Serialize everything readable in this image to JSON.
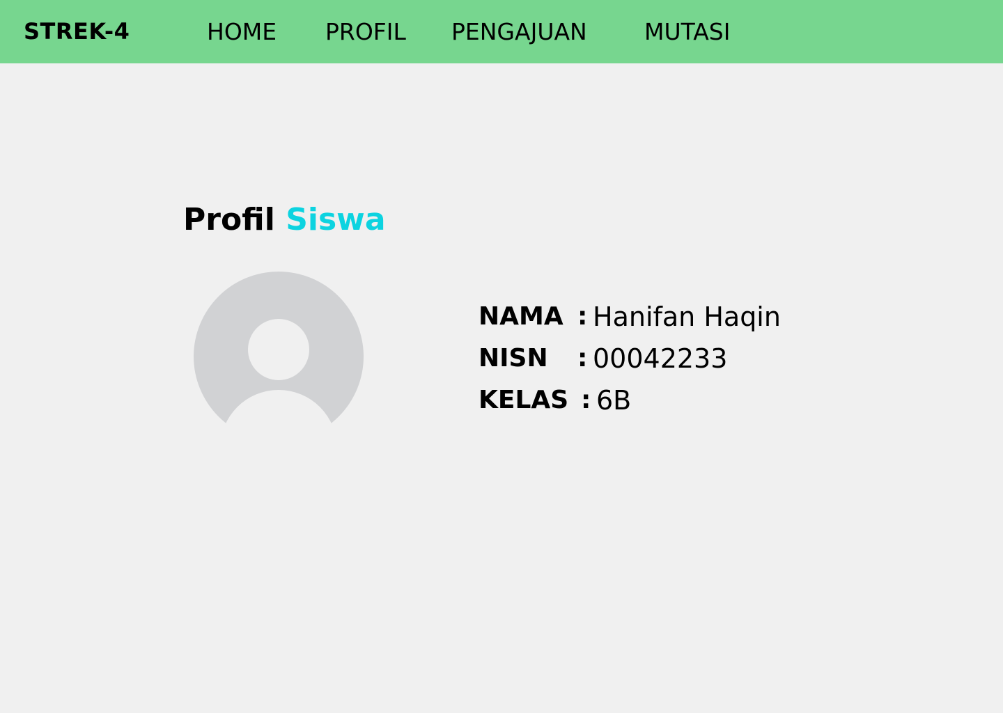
{
  "navbar": {
    "brand": "STREK-4",
    "links": [
      "HOME",
      "PROFIL",
      "PENGAJUAN",
      "MUTASI"
    ],
    "background_color": "#77d68f"
  },
  "page": {
    "title_part1": "Profil",
    "title_part2": "Siswa",
    "title_accent_color": "#0cd3e0",
    "background_color": "#f0f0f0"
  },
  "avatar": {
    "icon": "user-placeholder-icon",
    "color": "#d1d2d4"
  },
  "profile": {
    "fields": [
      {
        "label": "NAMA",
        "separator": ":",
        "value": "Hanifan Haqin"
      },
      {
        "label": "NISN",
        "separator": ":",
        "value": "00042233"
      },
      {
        "label": "KELAS",
        "separator": ":",
        "value": "6B"
      }
    ]
  }
}
